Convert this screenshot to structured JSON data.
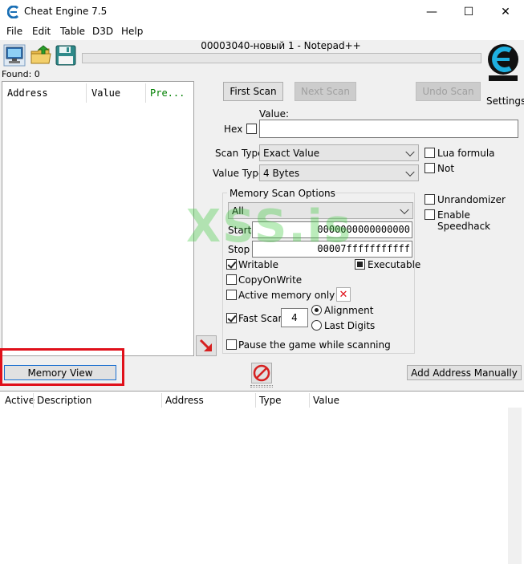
{
  "window": {
    "title": "Cheat Engine 7.5",
    "minimize_symbol": "—",
    "maximize_symbol": "☐",
    "close_symbol": "✕"
  },
  "menu": [
    "File",
    "Edit",
    "Table",
    "D3D",
    "Help"
  ],
  "toolbar": {
    "open_process_icon": "computer-icon",
    "open_file_icon": "folder-icon",
    "save_icon": "floppy-disk-icon"
  },
  "process_title": "00003040-новый 1 - Notepad++",
  "progress": 0,
  "found_label": "Found: 0",
  "results_columns": [
    "Address",
    "Value",
    "Pre..."
  ],
  "scan_buttons": {
    "first_scan": "First Scan",
    "next_scan": "Next Scan",
    "undo_scan": "Undo Scan"
  },
  "settings_label": "Settings",
  "value_label": "Value:",
  "value_input": "",
  "hex_label": "Hex",
  "scan_type_label": "Scan Type",
  "scan_type_value": "Exact Value",
  "value_type_label": "Value Type",
  "value_type_value": "4 Bytes",
  "lua_formula_label": "Lua formula",
  "not_label": "Not",
  "memory_scan_options_label": "Memory Scan Options",
  "memory_region_value": "All",
  "start_label": "Start",
  "start_value": "0000000000000000",
  "stop_label": "Stop",
  "stop_value": "00007fffffffffff",
  "writable_label": "Writable",
  "executable_label": "Executable",
  "copy_on_write_label": "CopyOnWrite",
  "active_memory_label": "Active memory only",
  "fast_scan_label": "Fast Scan",
  "fast_scan_value": "4",
  "alignment_label": "Alignment",
  "last_digits_label": "Last Digits",
  "pause_label": "Pause the game while scanning",
  "unrandomizer_label": "Unrandomizer",
  "speedhack_label": "Enable Speedhack",
  "memory_view_button": "Memory View",
  "add_address_button": "Add Address Manually",
  "table_columns": [
    "Active",
    "Description",
    "Address",
    "Type",
    "Value"
  ],
  "watermark": "XSS.is",
  "colors": {
    "highlight": "#e0101a",
    "watermark": "#3cc83c",
    "accent_cyan": "#00a0c8"
  }
}
